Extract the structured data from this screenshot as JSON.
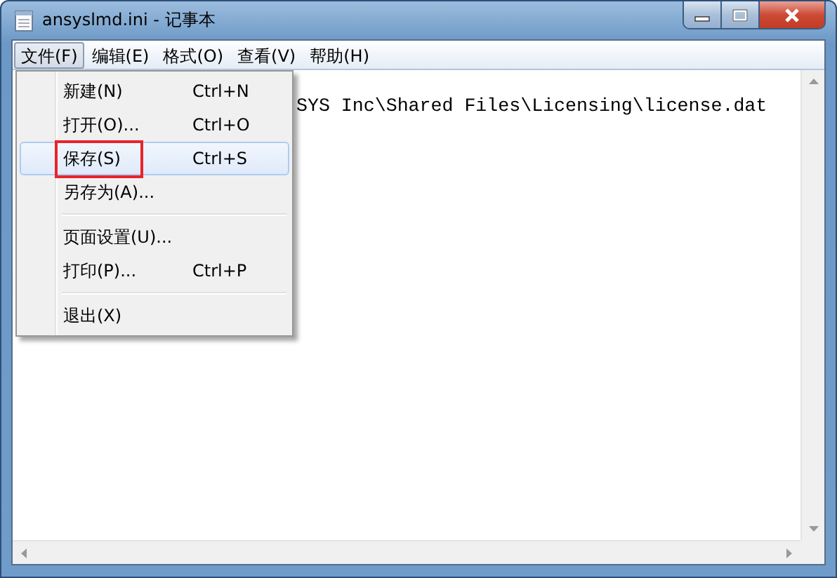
{
  "window": {
    "title": "ansyslmd.ini - 记事本"
  },
  "menu_bar": [
    {
      "label": "文件(F)",
      "selected": true
    },
    {
      "label": "编辑(E)",
      "selected": false
    },
    {
      "label": "格式(O)",
      "selected": false
    },
    {
      "label": "查看(V)",
      "selected": false
    },
    {
      "label": "帮助(H)",
      "selected": false
    }
  ],
  "file_menu": {
    "items": [
      {
        "kind": "item",
        "label": "新建(N)",
        "shortcut": "Ctrl+N",
        "selected": false,
        "annotated": false
      },
      {
        "kind": "item",
        "label": "打开(O)...",
        "shortcut": "Ctrl+O",
        "selected": false,
        "annotated": false
      },
      {
        "kind": "item",
        "label": "保存(S)",
        "shortcut": "Ctrl+S",
        "selected": true,
        "annotated": true
      },
      {
        "kind": "item",
        "label": "另存为(A)...",
        "selected": false,
        "annotated": false
      },
      {
        "kind": "separator"
      },
      {
        "kind": "item",
        "label": "页面设置(U)...",
        "selected": false,
        "annotated": false
      },
      {
        "kind": "item",
        "label": "打印(P)...",
        "shortcut": "Ctrl+P",
        "selected": false,
        "annotated": false
      },
      {
        "kind": "separator"
      },
      {
        "kind": "item",
        "label": "退出(X)",
        "selected": false,
        "annotated": false
      }
    ]
  },
  "editor": {
    "lines": [
      "SYS Inc\\Shared Files\\Licensing\\license.dat"
    ]
  }
}
